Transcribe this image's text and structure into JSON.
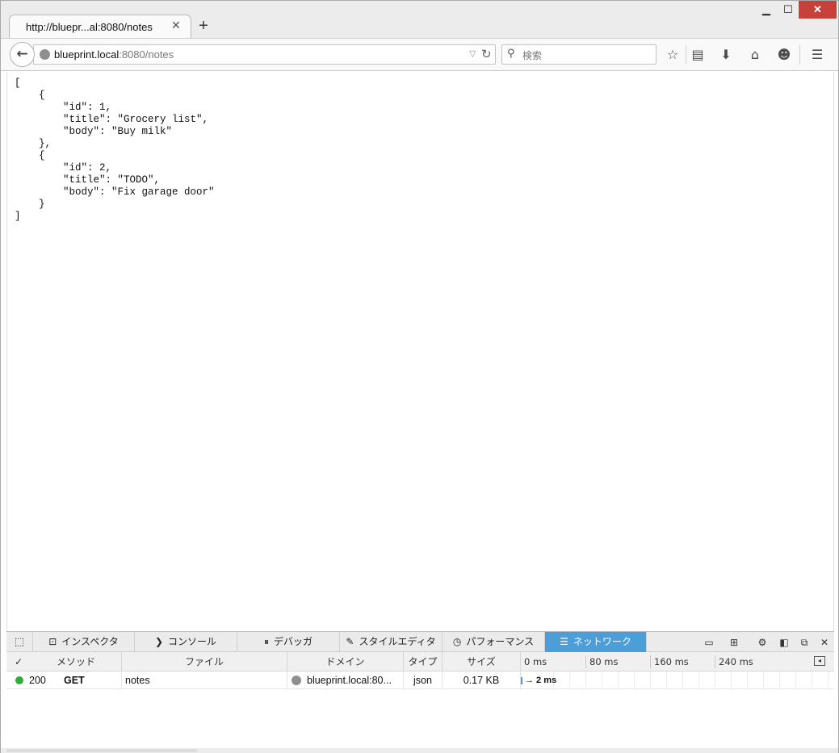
{
  "browser": {
    "tab_title": "http://bluepr...al:8080/notes",
    "tab_close": "✕",
    "new_tab": "+",
    "window_controls": {
      "minimize": "▁",
      "maximize": "☐",
      "close": "✕"
    },
    "url": {
      "host": "blueprint.local",
      "rest": ":8080/notes"
    },
    "search_placeholder": "検索",
    "toolbar_icons": [
      "star-icon",
      "reading-list-icon",
      "download-icon",
      "home-icon",
      "hello-icon",
      "menu-icon"
    ]
  },
  "content": {
    "json_lines": [
      "[",
      "    {",
      "        \"id\": 1,",
      "        \"title\": \"Grocery list\",",
      "        \"body\": \"Buy milk\"",
      "    },",
      "    {",
      "        \"id\": 2,",
      "        \"title\": \"TODO\",",
      "        \"body\": \"Fix garage door\"",
      "    }",
      "]"
    ]
  },
  "devtools": {
    "tabs": [
      {
        "label": "インスペクタ",
        "icon": "inspector-icon",
        "glyph": "⊡"
      },
      {
        "label": "コンソール",
        "icon": "console-icon",
        "glyph": "❯"
      },
      {
        "label": "デバッガ",
        "icon": "debugger-icon",
        "glyph": "⏸"
      },
      {
        "label": "スタイルエディタ",
        "icon": "style-editor-icon",
        "glyph": "✎"
      },
      {
        "label": "パフォーマンス",
        "icon": "performance-icon",
        "glyph": "◷"
      },
      {
        "label": "ネットワーク",
        "icon": "network-icon",
        "glyph": "☰"
      }
    ],
    "active_tab": "ネットワーク",
    "network": {
      "headers": {
        "check": "✓",
        "method": "メソッド",
        "file": "ファイル",
        "domain": "ドメイン",
        "type": "タイプ",
        "size": "サイズ"
      },
      "timeline_ticks": [
        "0 ms",
        "80 ms",
        "160 ms",
        "240 ms"
      ],
      "requests": [
        {
          "status": "200",
          "method": "GET",
          "file": "notes",
          "domain": "blueprint.local:80...",
          "type": "json",
          "size": "0.17 KB",
          "timing": "→ 2 ms"
        }
      ]
    }
  },
  "colors": {
    "active_tab": "#4c9ed9",
    "status_ok": "#2fae36",
    "close_button": "#c7403a"
  }
}
